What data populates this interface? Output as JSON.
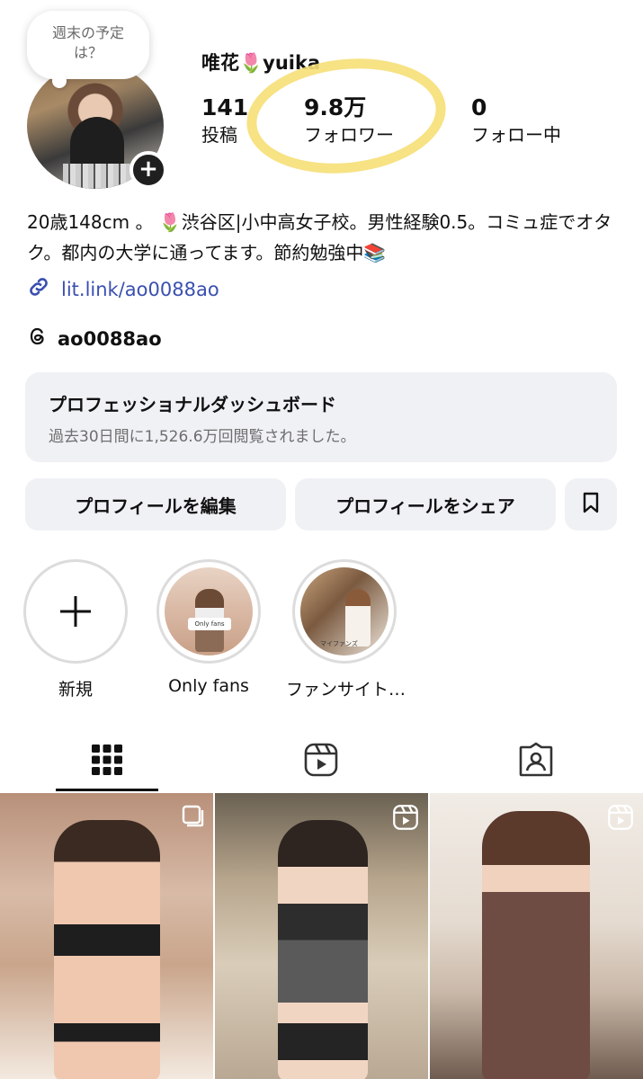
{
  "profile": {
    "note": "週末の予定は？",
    "username": "唯花🌷yuika",
    "stats": [
      {
        "value": "141",
        "label": "投稿"
      },
      {
        "value": "9.8万",
        "label": "フォロワー"
      },
      {
        "value": "0",
        "label": "フォロー中"
      }
    ],
    "bio": "20歳148cm 。 🌷渋谷区|小中高女子校。男性経験0.5。コミュ症でオタク。都内の大学に通ってます。節約勉強中📚",
    "link": "lit.link/ao0088ao",
    "threads_handle": "ao0088ao"
  },
  "dashboard": {
    "title": "プロフェッショナルダッシュボード",
    "subtitle": "過去30日間に1,526.6万回閲覧されました。"
  },
  "buttons": {
    "edit": "プロフィールを編集",
    "share": "プロフィールをシェア"
  },
  "highlights": [
    {
      "label": "新規"
    },
    {
      "label": "Only fans"
    },
    {
      "label": "ファンサイト…"
    }
  ],
  "highlight_thumbs": {
    "of_tag": "Only fans",
    "fan_tag": "マイファンズ"
  },
  "tabs": [
    "grid",
    "reels",
    "tagged"
  ],
  "colors": {
    "link": "#3a4fb0",
    "highlight_ring": "#f6df77",
    "button_bg": "#f0f1f5"
  }
}
